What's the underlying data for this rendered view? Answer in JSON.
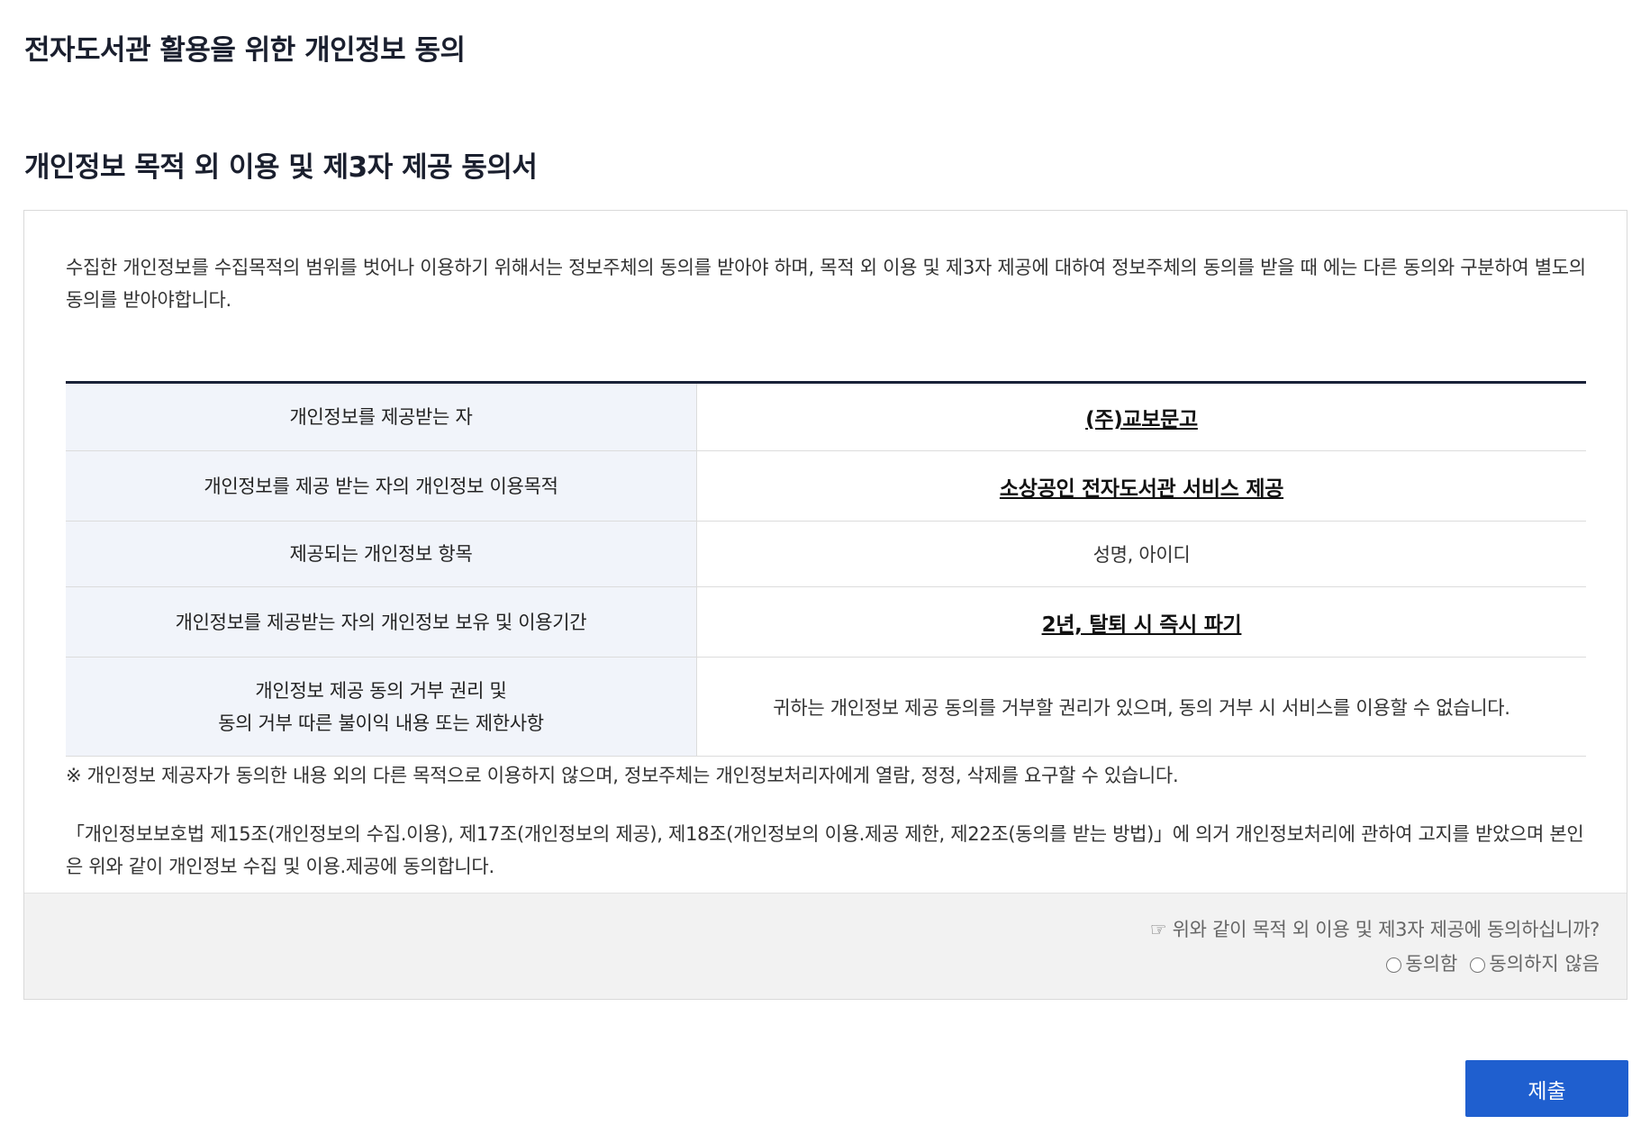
{
  "page": {
    "title": "전자도서관 활용을 위한 개인정보 동의"
  },
  "section": {
    "title": "개인정보 목적 외 이용 및 제3자 제공 동의서"
  },
  "consent": {
    "intro": "수집한 개인정보를 수집목적의 범위를 벗어나 이용하기 위해서는 정보주체의 동의를 받아야 하며, 목적 외 이용 및 제3자 제공에 대하여 정보주체의 동의를 받을 때 에는 다른 동의와 구분하여 별도의 동의를 받아야합니다.",
    "table": [
      {
        "label": "개인정보를 제공받는 자",
        "value": "(주)교보문고"
      },
      {
        "label": "개인정보를 제공 받는 자의 개인정보 이용목적",
        "value": "소상공인 전자도서관 서비스 제공"
      },
      {
        "label": "제공되는 개인정보 항목",
        "value": "성명, 아이디"
      },
      {
        "label": "개인정보를 제공받는 자의 개인정보 보유 및 이용기간",
        "value": "2년, 탈퇴 시 즉시 파기"
      },
      {
        "label_line1": "개인정보 제공 동의 거부 권리 및",
        "label_line2": "동의 거부 따른 불이익 내용 또는 제한사항",
        "value": "귀하는 개인정보 제공 동의를 거부할 권리가 있으며, 동의 거부 시 서비스를 이용할 수 없습니다."
      }
    ],
    "notice": "※ 개인정보 제공자가 동의한 내용 외의 다른 목적으로 이용하지 않으며, 정보주체는 개인정보처리자에게 열람, 정정, 삭제를 요구할 수 있습니다.",
    "law": "「개인정보보호법 제15조(개인정보의 수집.이용), 제17조(개인정보의 제공), 제18조(개인정보의 이용.제공 제한, 제22조(동의를 받는 방법)」에 의거 개인정보처리에 관하여 고지를 받았으며 본인은 위와 같이 개인정보 수집 및 이용.제공에 동의합니다."
  },
  "agreement": {
    "question": "☞ 위와 같이 목적 외 이용 및 제3자 제공에 동의하십니까?",
    "options": [
      {
        "label": "동의함"
      },
      {
        "label": "동의하지 않음"
      }
    ]
  },
  "actions": {
    "submit_label": "제출"
  },
  "colors": {
    "primary": "#1f5fcf",
    "table_header_bg": "#f1f4fa",
    "table_top_border": "#1a2238",
    "agree_bar_bg": "#f2f2f2"
  }
}
